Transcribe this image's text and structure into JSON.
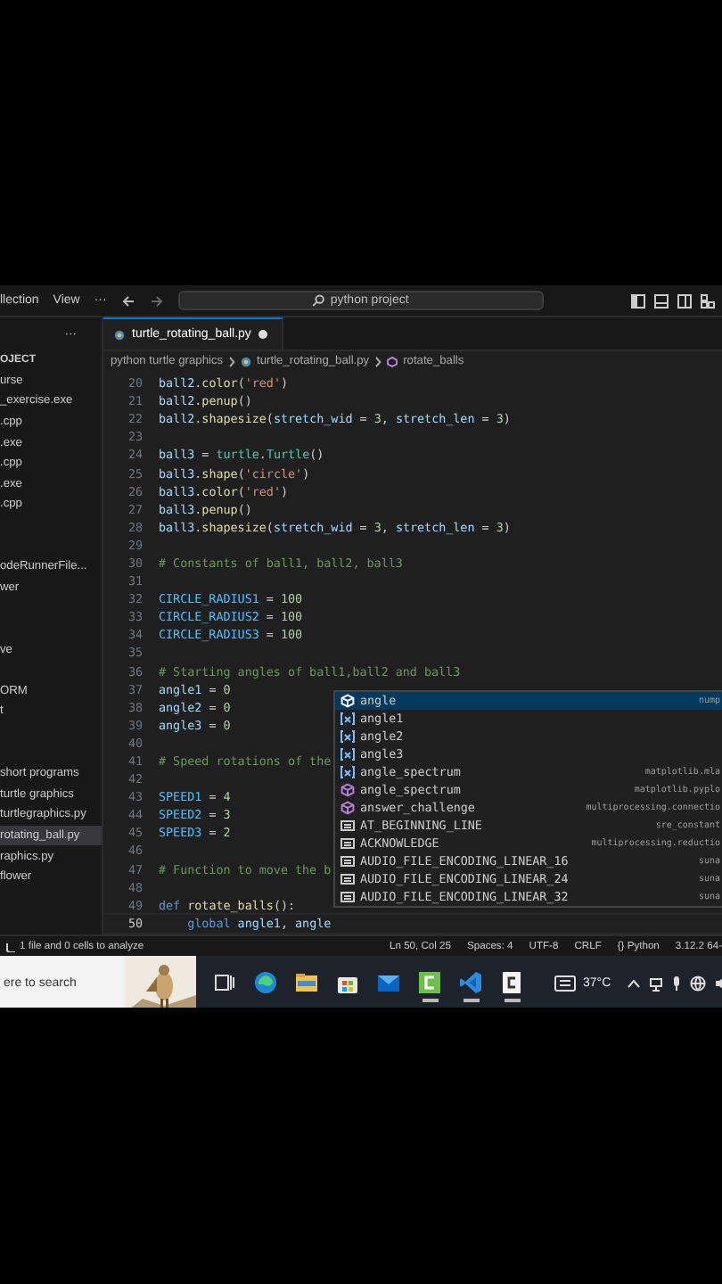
{
  "menu": [
    {
      "label": "llection"
    },
    {
      "label": "View"
    },
    {
      "label": "···"
    }
  ],
  "command_center": {
    "text": "python project"
  },
  "sidebar": {
    "more": "···",
    "items": [
      {
        "label": "OJECT",
        "kind": "heading",
        "selected": false
      },
      {
        "label": "urse",
        "kind": "file",
        "selected": false
      },
      {
        "label": "_exercise.exe",
        "kind": "file",
        "selected": false
      },
      {
        "label": ".cpp",
        "kind": "file",
        "selected": false
      },
      {
        "label": ".exe",
        "kind": "file",
        "selected": false
      },
      {
        "label": ".cpp",
        "kind": "file",
        "selected": false
      },
      {
        "label": ".exe",
        "kind": "file",
        "selected": false
      },
      {
        "label": ".cpp",
        "kind": "file",
        "selected": false
      },
      {
        "label": "odeRunnerFile...",
        "kind": "file",
        "selected": false
      },
      {
        "label": "wer",
        "kind": "file",
        "selected": false
      },
      {
        "label": "ve",
        "kind": "file",
        "selected": false
      },
      {
        "label": "ORM",
        "kind": "file",
        "selected": false
      },
      {
        "label": "t",
        "kind": "file",
        "selected": false
      },
      {
        "label": "short programs",
        "kind": "file",
        "selected": false
      },
      {
        "label": "turtle graphics",
        "kind": "file",
        "selected": false
      },
      {
        "label": "turtlegraphics.py",
        "kind": "file",
        "selected": false
      },
      {
        "label": "rotating_ball.py",
        "kind": "file",
        "selected": true
      },
      {
        "label": "raphics.py",
        "kind": "file",
        "selected": false
      },
      {
        "label": "flower",
        "kind": "file",
        "selected": false
      }
    ]
  },
  "tabs": [
    {
      "label": "turtle_rotating_ball.py",
      "modified": true,
      "selected": true
    }
  ],
  "breadcrumb": [
    {
      "label": "python turtle graphics",
      "kind": "folder"
    },
    {
      "label": "turtle_rotating_ball.py",
      "kind": "file"
    },
    {
      "label": "rotate_balls",
      "kind": "function"
    }
  ],
  "editor": {
    "lines": [
      {
        "number": "20",
        "current": false,
        "tokens": [
          {
            "kind": "v",
            "text": "ball2"
          },
          {
            "kind": "p",
            "text": "."
          },
          {
            "kind": "f",
            "text": "color"
          },
          {
            "kind": "p",
            "text": "("
          },
          {
            "kind": "s",
            "text": "'red'"
          },
          {
            "kind": "p",
            "text": ")"
          }
        ]
      },
      {
        "number": "21",
        "current": false,
        "tokens": [
          {
            "kind": "v",
            "text": "ball2"
          },
          {
            "kind": "p",
            "text": "."
          },
          {
            "kind": "f",
            "text": "penup"
          },
          {
            "kind": "p",
            "text": "()"
          }
        ]
      },
      {
        "number": "22",
        "current": false,
        "tokens": [
          {
            "kind": "v",
            "text": "ball2"
          },
          {
            "kind": "p",
            "text": "."
          },
          {
            "kind": "f",
            "text": "shapesize"
          },
          {
            "kind": "p",
            "text": "("
          },
          {
            "kind": "v",
            "text": "stretch_wid"
          },
          {
            "kind": "p",
            "text": " = "
          },
          {
            "kind": "n",
            "text": "3"
          },
          {
            "kind": "p",
            "text": ", "
          },
          {
            "kind": "v",
            "text": "stretch_len"
          },
          {
            "kind": "p",
            "text": " = "
          },
          {
            "kind": "n",
            "text": "3"
          },
          {
            "kind": "p",
            "text": ")"
          }
        ]
      },
      {
        "number": "23",
        "current": false
      },
      {
        "number": "24",
        "current": false,
        "tokens": [
          {
            "kind": "v",
            "text": "ball3"
          },
          {
            "kind": "p",
            "text": " = "
          },
          {
            "kind": "t",
            "text": "turtle"
          },
          {
            "kind": "p",
            "text": "."
          },
          {
            "kind": "t",
            "text": "Turtle"
          },
          {
            "kind": "p",
            "text": "()"
          }
        ]
      },
      {
        "number": "25",
        "current": false,
        "tokens": [
          {
            "kind": "v",
            "text": "ball3"
          },
          {
            "kind": "p",
            "text": "."
          },
          {
            "kind": "f",
            "text": "shape"
          },
          {
            "kind": "p",
            "text": "("
          },
          {
            "kind": "s",
            "text": "'circle'"
          },
          {
            "kind": "p",
            "text": ")"
          }
        ]
      },
      {
        "number": "26",
        "current": false,
        "tokens": [
          {
            "kind": "v",
            "text": "ball3"
          },
          {
            "kind": "p",
            "text": "."
          },
          {
            "kind": "f",
            "text": "color"
          },
          {
            "kind": "p",
            "text": "("
          },
          {
            "kind": "s",
            "text": "'red'"
          },
          {
            "kind": "p",
            "text": ")"
          }
        ]
      },
      {
        "number": "27",
        "current": false,
        "tokens": [
          {
            "kind": "v",
            "text": "ball3"
          },
          {
            "kind": "p",
            "text": "."
          },
          {
            "kind": "f",
            "text": "penup"
          },
          {
            "kind": "p",
            "text": "()"
          }
        ]
      },
      {
        "number": "28",
        "current": false,
        "tokens": [
          {
            "kind": "v",
            "text": "ball3"
          },
          {
            "kind": "p",
            "text": "."
          },
          {
            "kind": "f",
            "text": "shapesize"
          },
          {
            "kind": "p",
            "text": "("
          },
          {
            "kind": "v",
            "text": "stretch_wid"
          },
          {
            "kind": "p",
            "text": " = "
          },
          {
            "kind": "n",
            "text": "3"
          },
          {
            "kind": "p",
            "text": ", "
          },
          {
            "kind": "v",
            "text": "stretch_len"
          },
          {
            "kind": "p",
            "text": " = "
          },
          {
            "kind": "n",
            "text": "3"
          },
          {
            "kind": "p",
            "text": ")"
          }
        ]
      },
      {
        "number": "29",
        "current": false
      },
      {
        "number": "30",
        "current": false,
        "tokens": [
          {
            "kind": "c",
            "text": "# Constants of ball1, ball2, ball3"
          }
        ]
      },
      {
        "number": "31",
        "current": false
      },
      {
        "number": "32",
        "current": false,
        "tokens": [
          {
            "kind": "o",
            "text": "CIRCLE_RADIUS1"
          },
          {
            "kind": "p",
            "text": " = "
          },
          {
            "kind": "n",
            "text": "100"
          }
        ]
      },
      {
        "number": "33",
        "current": false,
        "tokens": [
          {
            "kind": "o",
            "text": "CIRCLE_RADIUS2"
          },
          {
            "kind": "p",
            "text": " = "
          },
          {
            "kind": "n",
            "text": "100"
          }
        ]
      },
      {
        "number": "34",
        "current": false,
        "tokens": [
          {
            "kind": "o",
            "text": "CIRCLE_RADIUS3"
          },
          {
            "kind": "p",
            "text": " = "
          },
          {
            "kind": "n",
            "text": "100"
          }
        ]
      },
      {
        "number": "35",
        "current": false
      },
      {
        "number": "36",
        "current": false,
        "tokens": [
          {
            "kind": "c",
            "text": "# Starting angles of ball1,ball2 and ball3"
          }
        ]
      },
      {
        "number": "37",
        "current": false,
        "tokens": [
          {
            "kind": "v",
            "text": "angle1"
          },
          {
            "kind": "p",
            "text": " = "
          },
          {
            "kind": "n",
            "text": "0"
          }
        ]
      },
      {
        "number": "38",
        "current": false,
        "tokens": [
          {
            "kind": "v",
            "text": "angle2"
          },
          {
            "kind": "p",
            "text": " = "
          },
          {
            "kind": "n",
            "text": "0"
          }
        ]
      },
      {
        "number": "39",
        "current": false,
        "tokens": [
          {
            "kind": "v",
            "text": "angle3"
          },
          {
            "kind": "p",
            "text": " = "
          },
          {
            "kind": "n",
            "text": "0"
          }
        ]
      },
      {
        "number": "40",
        "current": false
      },
      {
        "number": "41",
        "current": false,
        "tokens": [
          {
            "kind": "c",
            "text": "# Speed rotations of the"
          }
        ]
      },
      {
        "number": "42",
        "current": false
      },
      {
        "number": "43",
        "current": false,
        "tokens": [
          {
            "kind": "o",
            "text": "SPEED1"
          },
          {
            "kind": "p",
            "text": " = "
          },
          {
            "kind": "n",
            "text": "4"
          }
        ]
      },
      {
        "number": "44",
        "current": false,
        "tokens": [
          {
            "kind": "o",
            "text": "SPEED2"
          },
          {
            "kind": "p",
            "text": " = "
          },
          {
            "kind": "n",
            "text": "3"
          }
        ]
      },
      {
        "number": "45",
        "current": false,
        "tokens": [
          {
            "kind": "o",
            "text": "SPEED3"
          },
          {
            "kind": "p",
            "text": " = "
          },
          {
            "kind": "n",
            "text": "2"
          }
        ]
      },
      {
        "number": "46",
        "current": false
      },
      {
        "number": "47",
        "current": false,
        "tokens": [
          {
            "kind": "c",
            "text": "# Function to move the b"
          }
        ]
      },
      {
        "number": "48",
        "current": false
      },
      {
        "number": "49",
        "current": false,
        "tokens": [
          {
            "kind": "k",
            "text": "def "
          },
          {
            "kind": "f",
            "text": "rotate_balls"
          },
          {
            "kind": "p",
            "text": "():"
          }
        ]
      },
      {
        "number": "50",
        "current": true,
        "tokens": [
          {
            "kind": "k",
            "text": "    global "
          },
          {
            "kind": "v",
            "text": "angle1"
          },
          {
            "kind": "p",
            "text": ", "
          },
          {
            "kind": "v",
            "text": "angle"
          }
        ]
      }
    ]
  },
  "suggestions": [
    {
      "label": "angle",
      "detail": "nump",
      "kind": "module",
      "selected": true
    },
    {
      "label": "angle1",
      "kind": "variable",
      "selected": false
    },
    {
      "label": "angle2",
      "kind": "variable",
      "selected": false
    },
    {
      "label": "angle3",
      "kind": "variable",
      "selected": false
    },
    {
      "label": "angle_spectrum",
      "detail": "matplotlib.mla",
      "kind": "variable",
      "selected": false
    },
    {
      "label": "angle_spectrum",
      "detail": "matplotlib.pyplo",
      "kind": "function",
      "selected": false
    },
    {
      "label": "answer_challenge",
      "detail": "multiprocessing.connectio",
      "kind": "function",
      "selected": false
    },
    {
      "label": "AT_BEGINNING_LINE",
      "detail": "sre_constant",
      "kind": "constant",
      "selected": false
    },
    {
      "label": "ACKNOWLEDGE",
      "detail": "multiprocessing.reductio",
      "kind": "constant",
      "selected": false
    },
    {
      "label": "AUDIO_FILE_ENCODING_LINEAR_16",
      "detail": "suna",
      "kind": "constant",
      "selected": false
    },
    {
      "label": "AUDIO_FILE_ENCODING_LINEAR_24",
      "detail": "suna",
      "kind": "constant",
      "selected": false
    },
    {
      "label": "AUDIO_FILE_ENCODING_LINEAR_32",
      "detail": "suna",
      "kind": "constant",
      "selected": false
    }
  ],
  "status_bar": {
    "left": "1 file and 0 cells to analyze",
    "right": [
      "Ln 50, Col 25",
      "Spaces: 4",
      "UTF-8",
      "CRLF",
      "{} Python",
      "3.12.2 64-"
    ]
  },
  "taskbar": {
    "search": {
      "placeholder": "ere to search"
    },
    "apps": [
      {
        "kind": "taskview",
        "running": false
      },
      {
        "kind": "edge",
        "running": false
      },
      {
        "kind": "explorer",
        "running": false
      },
      {
        "kind": "store",
        "running": false
      },
      {
        "kind": "mail",
        "running": false
      },
      {
        "kind": "codeblocks",
        "running": true
      },
      {
        "kind": "vscode",
        "running": true
      },
      {
        "kind": "cfile",
        "running": true
      }
    ],
    "weather": "37°C"
  }
}
